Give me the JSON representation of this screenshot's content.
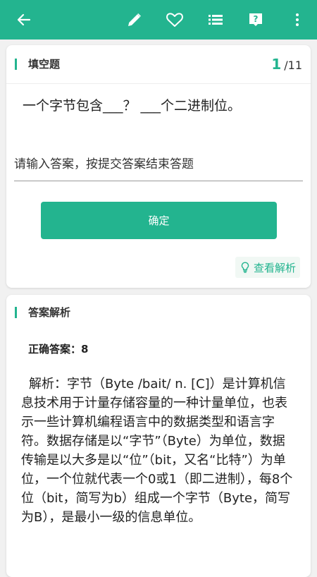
{
  "colors": {
    "accent": "#23b48f",
    "background": "#f1f1f1",
    "card": "#ffffff",
    "text": "#222222"
  },
  "toolbar": {
    "icons": [
      "back-arrow-icon",
      "pencil-icon",
      "heart-icon",
      "list-icon",
      "help-icon",
      "more-vertical-icon"
    ]
  },
  "question_card": {
    "title": "填空题",
    "current_index": "1",
    "total": "/11",
    "question_text": "一个字节包含___？ ___个二进制位。",
    "input_placeholder": "请输入答案，按提交答案结束答题",
    "input_value": "",
    "confirm_label": "确定",
    "view_analysis_label": "查看解析",
    "view_analysis_icon": "lightbulb-icon"
  },
  "analysis_card": {
    "title": "答案解析",
    "correct_answer": "正确答案：8",
    "explanation": "解析：字节（Byte /bait/ n. [C]）是计算机信息技术用于计量存储容量的一种计量单位，也表示一些计算机编程语言中的数据类型和语言字符。数据存储是以“字节”（Byte）为单位，数据传输是以大多是以“位”（bit，又名“比特”）为单位，一个位就代表一个0或1（即二进制），每8个位（bit，简写为b）组成一个字节（Byte，简写为B），是最小一级的信息单位。"
  }
}
